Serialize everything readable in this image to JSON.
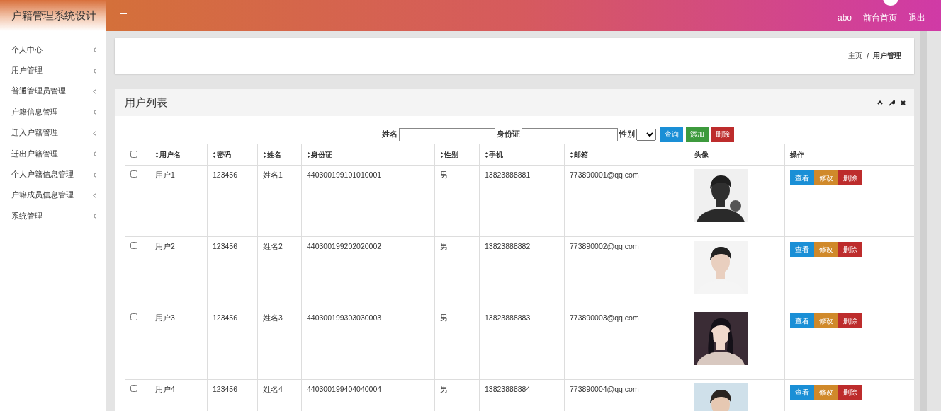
{
  "app": {
    "title": "户籍管理系统设计"
  },
  "topbar": {
    "user": "abo",
    "links": [
      "前台首页",
      "退出"
    ]
  },
  "sidebar": {
    "items": [
      {
        "label": "个人中心",
        "expanded": false
      },
      {
        "label": "用户管理",
        "expanded": false
      },
      {
        "label": "普通管理员管理",
        "expanded": false
      },
      {
        "label": "户籍信息管理",
        "expanded": false
      },
      {
        "label": "迁入户籍管理",
        "expanded": false
      },
      {
        "label": "迁出户籍管理",
        "expanded": false
      },
      {
        "label": "个人户籍信息管理",
        "expanded": false
      },
      {
        "label": "户籍成员信息管理",
        "expanded": false
      },
      {
        "label": "系统管理",
        "expanded": false
      }
    ]
  },
  "breadcrumb": {
    "items": [
      "主页",
      "用户管理"
    ],
    "separator": "/"
  },
  "panel": {
    "title": "用户列表",
    "search": {
      "fields": [
        {
          "label": "姓名",
          "kind": "text"
        },
        {
          "label": "身份证",
          "kind": "text"
        },
        {
          "label": "性别",
          "kind": "select"
        }
      ],
      "buttons": [
        {
          "label": "查询",
          "kind": "primary"
        },
        {
          "label": "添加",
          "kind": "success"
        },
        {
          "label": "删除",
          "kind": "danger"
        }
      ]
    },
    "table": {
      "select_all": {
        "checked": false
      },
      "columns": [
        {
          "label": "用户名",
          "sortable": true
        },
        {
          "label": "密码",
          "sortable": true
        },
        {
          "label": "姓名",
          "sortable": true
        },
        {
          "label": "身份证",
          "sortable": true
        },
        {
          "label": "性别",
          "sortable": true
        },
        {
          "label": "手机",
          "sortable": true
        },
        {
          "label": "邮箱",
          "sortable": true
        },
        {
          "label": "头像",
          "sortable": false
        },
        {
          "label": "操作",
          "sortable": false
        }
      ],
      "rows": [
        {
          "checked": false,
          "cells": [
            "用户1",
            "123456",
            "姓名1",
            "440300199101010001",
            "男",
            "13823888881",
            "773890001@qq.com"
          ],
          "avatar": {
            "kind": "picture"
          },
          "actions": [
            {
              "label": "查看",
              "kind": "primary"
            },
            {
              "label": "修改",
              "kind": "warning"
            },
            {
              "label": "删除",
              "kind": "danger"
            }
          ]
        },
        {
          "checked": false,
          "cells": [
            "用户2",
            "123456",
            "姓名2",
            "440300199202020002",
            "男",
            "13823888882",
            "773890002@qq.com"
          ],
          "avatar": {
            "kind": "picture"
          },
          "actions": [
            {
              "label": "查看",
              "kind": "primary"
            },
            {
              "label": "修改",
              "kind": "warning"
            },
            {
              "label": "删除",
              "kind": "danger"
            }
          ]
        },
        {
          "checked": false,
          "cells": [
            "用户3",
            "123456",
            "姓名3",
            "440300199303030003",
            "男",
            "13823888883",
            "773890003@qq.com"
          ],
          "avatar": {
            "kind": "picture"
          },
          "actions": [
            {
              "label": "查看",
              "kind": "primary"
            },
            {
              "label": "修改",
              "kind": "warning"
            },
            {
              "label": "删除",
              "kind": "danger"
            }
          ]
        },
        {
          "checked": false,
          "cells": [
            "用户4",
            "123456",
            "姓名4",
            "440300199404040004",
            "男",
            "13823888884",
            "773890004@qq.com"
          ],
          "avatar": {
            "kind": "picture"
          },
          "actions": [
            {
              "label": "查看",
              "kind": "primary"
            },
            {
              "label": "修改",
              "kind": "warning"
            },
            {
              "label": "删除",
              "kind": "danger"
            }
          ]
        }
      ]
    }
  }
}
